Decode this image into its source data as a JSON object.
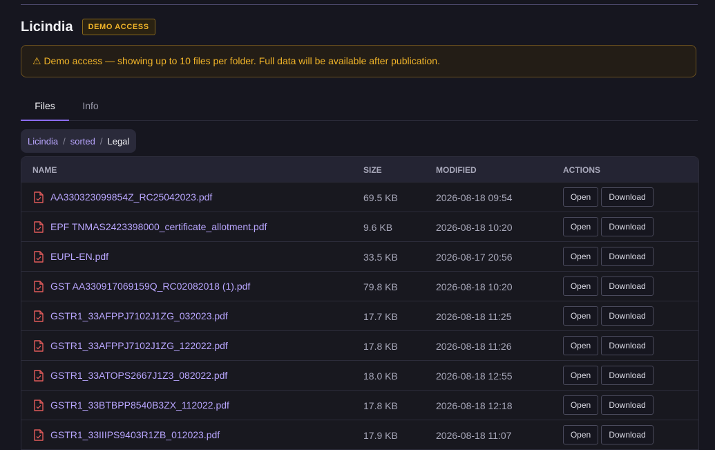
{
  "header": {
    "title": "Licindia",
    "badge": "DEMO ACCESS"
  },
  "alert": {
    "icon": "warning-icon",
    "text": "⚠ Demo access — showing up to 10 files per folder. Full data will be available after publication."
  },
  "tabs": [
    {
      "label": "Files",
      "active": true
    },
    {
      "label": "Info",
      "active": false
    }
  ],
  "breadcrumb": {
    "items": [
      "Licindia",
      "sorted"
    ],
    "separator": "/",
    "current": "Legal"
  },
  "table": {
    "columns": {
      "name": "NAME",
      "size": "SIZE",
      "modified": "MODIFIED",
      "actions": "ACTIONS"
    },
    "open_label": "Open",
    "download_label": "Download",
    "rows": [
      {
        "name": "AA330323099854Z_RC25042023.pdf",
        "size": "69.5 KB",
        "modified": "2026-08-18 09:54"
      },
      {
        "name": "EPF TNMAS2423398000_certificate_allotment.pdf",
        "size": "9.6 KB",
        "modified": "2026-08-18 10:20"
      },
      {
        "name": "EUPL-EN.pdf",
        "size": "33.5 KB",
        "modified": "2026-08-17 20:56"
      },
      {
        "name": "GST AA330917069159Q_RC02082018 (1).pdf",
        "size": "79.8 KB",
        "modified": "2026-08-18 10:20"
      },
      {
        "name": "GSTR1_33AFPPJ7102J1ZG_032023.pdf",
        "size": "17.7 KB",
        "modified": "2026-08-18 11:25"
      },
      {
        "name": "GSTR1_33AFPPJ7102J1ZG_122022.pdf",
        "size": "17.8 KB",
        "modified": "2026-08-18 11:26"
      },
      {
        "name": "GSTR1_33ATOPS2667J1Z3_082022.pdf",
        "size": "18.0 KB",
        "modified": "2026-08-18 12:55"
      },
      {
        "name": "GSTR1_33BTBPP8540B3ZX_112022.pdf",
        "size": "17.8 KB",
        "modified": "2026-08-18 12:18"
      },
      {
        "name": "GSTR1_33IIIPS9403R1ZB_012023.pdf",
        "size": "17.9 KB",
        "modified": "2026-08-18 11:07"
      }
    ]
  },
  "colors": {
    "accent": "#8b6cf0",
    "link": "#b9a6ff",
    "warning": "#f0b429",
    "pdf_icon": "#e05a5a"
  }
}
